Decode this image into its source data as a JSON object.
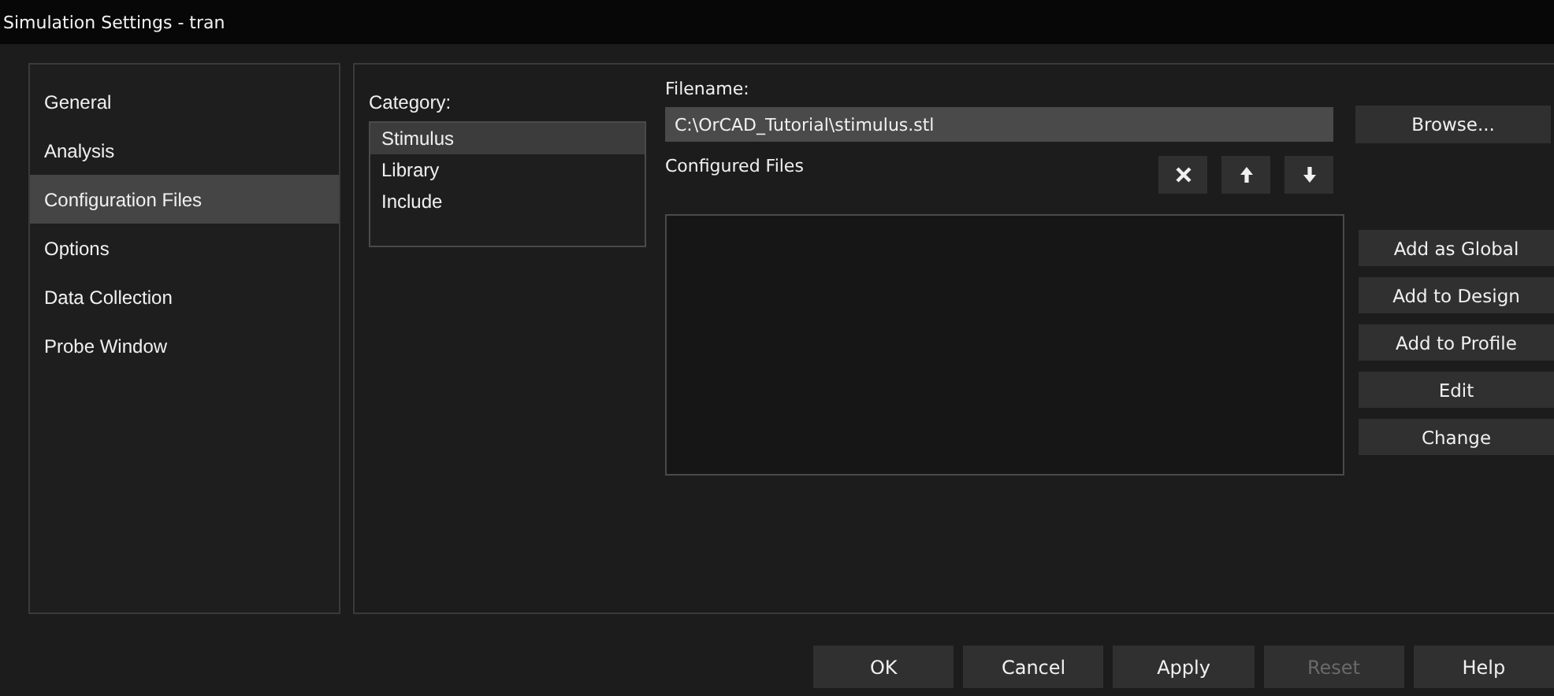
{
  "window": {
    "title": "Simulation Settings - tran"
  },
  "sidebar": {
    "items": [
      {
        "label": "General",
        "selected": false
      },
      {
        "label": "Analysis",
        "selected": false
      },
      {
        "label": "Configuration Files",
        "selected": true
      },
      {
        "label": "Options",
        "selected": false
      },
      {
        "label": "Data Collection",
        "selected": false
      },
      {
        "label": "Probe Window",
        "selected": false
      }
    ]
  },
  "category": {
    "label": "Category:",
    "items": [
      {
        "label": "Stimulus",
        "selected": true
      },
      {
        "label": "Library",
        "selected": false
      },
      {
        "label": "Include",
        "selected": false
      }
    ]
  },
  "filename": {
    "label": "Filename:",
    "value": "C:\\OrCAD_Tutorial\\stimulus.stl",
    "browse": "Browse..."
  },
  "configured_files": {
    "label": "Configured Files",
    "tools": [
      {
        "kind": "delete"
      },
      {
        "kind": "up"
      },
      {
        "kind": "down"
      }
    ],
    "buttons": [
      "Add as Global",
      "Add to Design",
      "Add to Profile",
      "Edit",
      "Change"
    ]
  },
  "footer": {
    "buttons": [
      {
        "label": "OK",
        "disabled": false
      },
      {
        "label": "Cancel",
        "disabled": false
      },
      {
        "label": "Apply",
        "disabled": false
      },
      {
        "label": "Reset",
        "disabled": true
      },
      {
        "label": "Help",
        "disabled": false
      }
    ]
  }
}
